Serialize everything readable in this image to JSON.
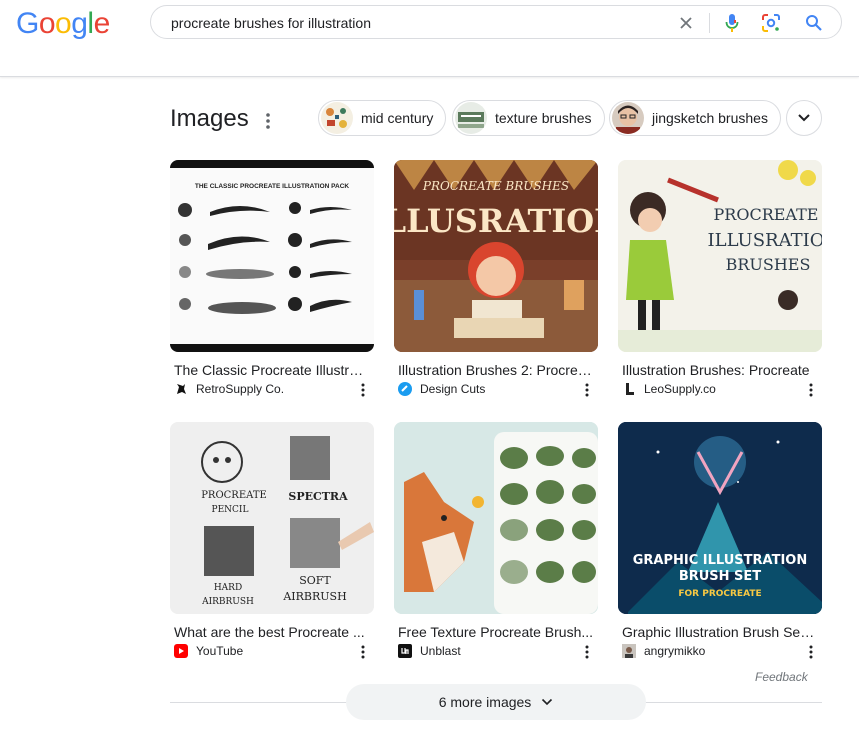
{
  "logo": {
    "text": "Google",
    "letters": [
      {
        "ch": "G",
        "color": "#4285F4"
      },
      {
        "ch": "o",
        "color": "#EA4335"
      },
      {
        "ch": "o",
        "color": "#FBBC05"
      },
      {
        "ch": "g",
        "color": "#4285F4"
      },
      {
        "ch": "l",
        "color": "#34A853"
      },
      {
        "ch": "e",
        "color": "#EA4335"
      }
    ]
  },
  "search": {
    "query": "procreate brushes for illustration",
    "icons": [
      "clear-icon",
      "microphone-icon",
      "lens-icon",
      "search-icon"
    ]
  },
  "images_section": {
    "title": "Images",
    "chips": [
      {
        "label": "mid century",
        "icon": "mid-century-thumb"
      },
      {
        "label": "texture brushes",
        "icon": "texture-brushes-thumb"
      },
      {
        "label": "jingsketch brushes",
        "icon": "jingsketch-thumb"
      }
    ],
    "results": [
      {
        "title": "The Classic Procreate Illustrat...",
        "source": "RetroSupply Co.",
        "thumb_heading": "THE CLASSIC PROCREATE ILLUSTRATION PACK"
      },
      {
        "title": "Illustration Brushes 2: Procrea...",
        "source": "Design Cuts",
        "thumb_heading": "PROCREATE BRUSHES",
        "thumb_big": "ILLUSRATION"
      },
      {
        "title": "Illustration Brushes: Procreate",
        "source": "LeoSupply.co",
        "thumb_heading": "PROCREATE",
        "thumb_big": "ILLUSRATIO",
        "thumb_sub": "BRUSHES"
      },
      {
        "title": "What are the best Procreate ...",
        "source": "YouTube",
        "thumb_labels": [
          "PROCREATE",
          "PENCIL",
          "SPECTRA",
          "HARD",
          "AIRBRUSH",
          "SOFT",
          "AIRBRUSH"
        ]
      },
      {
        "title": "Free Texture Procreate Brush...",
        "source": "Unblast"
      },
      {
        "title": "Graphic Illustration Brush Set ...",
        "source": "angrymikko",
        "thumb_heading": "GRAPHIC ILLUSTRATION",
        "thumb_big": "BRUSH SET",
        "thumb_sub": "FOR PROCREATE"
      }
    ],
    "feedback": "Feedback",
    "more_button": "6 more images"
  },
  "colors": {
    "border": "#dadce0",
    "text": "#202124",
    "muted": "#70757a",
    "blue": "#4285F4",
    "youtube_red": "#FF0000"
  }
}
